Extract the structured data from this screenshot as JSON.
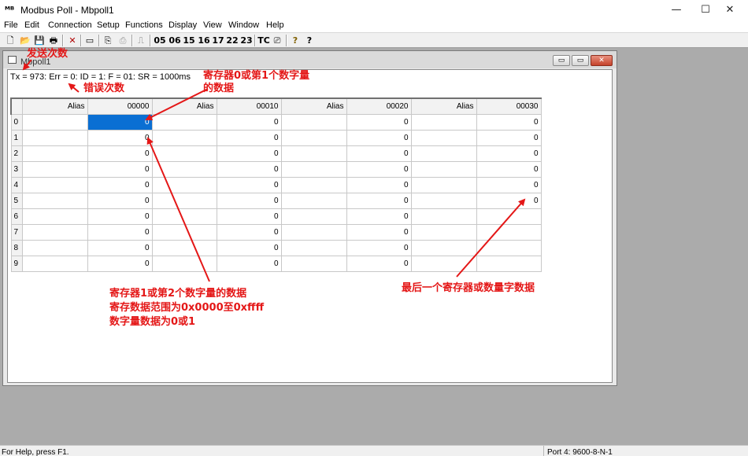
{
  "app": {
    "icon": "mb-logo-icon",
    "title": "Modbus Poll - Mbpoll1",
    "minimize": "—",
    "maximize": "☐",
    "close": "✕"
  },
  "menu": [
    "File",
    "Edit",
    "Connection",
    "Setup",
    "Functions",
    "Display",
    "View",
    "Window",
    "Help"
  ],
  "toolbar": {
    "new": "🗋",
    "open": "📂",
    "save": "💾",
    "print": "🖶",
    "delete": "✕",
    "window": "▭",
    "connect": "⎘",
    "disconnect": "⎙",
    "pulse": "⎍",
    "fc05": "05",
    "fc06": "06",
    "fc15": "15",
    "fc16": "16",
    "fc17": "17",
    "fc22": "22",
    "fc23": "23",
    "tc": "TC",
    "monitor": "⎚",
    "help": "?",
    "context_help": "?"
  },
  "child": {
    "title": "Mbpoll1",
    "status": "Tx = 973: Err = 0: ID = 1: F = 01: SR = 1000ms",
    "minimize": "▭",
    "restore": "▭",
    "close": "✕"
  },
  "table": {
    "headers": [
      "Alias",
      "00000",
      "Alias",
      "00010",
      "Alias",
      "00020",
      "Alias",
      "00030"
    ],
    "rows": [
      {
        "label": "0",
        "v0": "0",
        "v1": "0",
        "v2": "0",
        "v3": "0"
      },
      {
        "label": "1",
        "v0": "0",
        "v1": "0",
        "v2": "0",
        "v3": "0"
      },
      {
        "label": "2",
        "v0": "0",
        "v1": "0",
        "v2": "0",
        "v3": "0"
      },
      {
        "label": "3",
        "v0": "0",
        "v1": "0",
        "v2": "0",
        "v3": "0"
      },
      {
        "label": "4",
        "v0": "0",
        "v1": "0",
        "v2": "0",
        "v3": "0"
      },
      {
        "label": "5",
        "v0": "0",
        "v1": "0",
        "v2": "0",
        "v3": "0"
      },
      {
        "label": "6",
        "v0": "0",
        "v1": "0",
        "v2": "0",
        "v3": ""
      },
      {
        "label": "7",
        "v0": "0",
        "v1": "0",
        "v2": "0",
        "v3": ""
      },
      {
        "label": "8",
        "v0": "0",
        "v1": "0",
        "v2": "0",
        "v3": ""
      },
      {
        "label": "9",
        "v0": "0",
        "v1": "0",
        "v2": "0",
        "v3": ""
      }
    ]
  },
  "annotations": {
    "send_count": "发送次数",
    "error_count": "错误次数",
    "register0": "寄存器0或第1个数字量\n的数据",
    "register1": "寄存器1或第2个数字量的数据\n寄存数据范围为0x0000至0xffff\n数字量数据为0或1",
    "last_register": "最后一个寄存器或数量字数据",
    "color": "#e41717"
  },
  "statusbar": {
    "help": "For Help, press F1.",
    "port": "Port 4: 9600-8-N-1"
  }
}
